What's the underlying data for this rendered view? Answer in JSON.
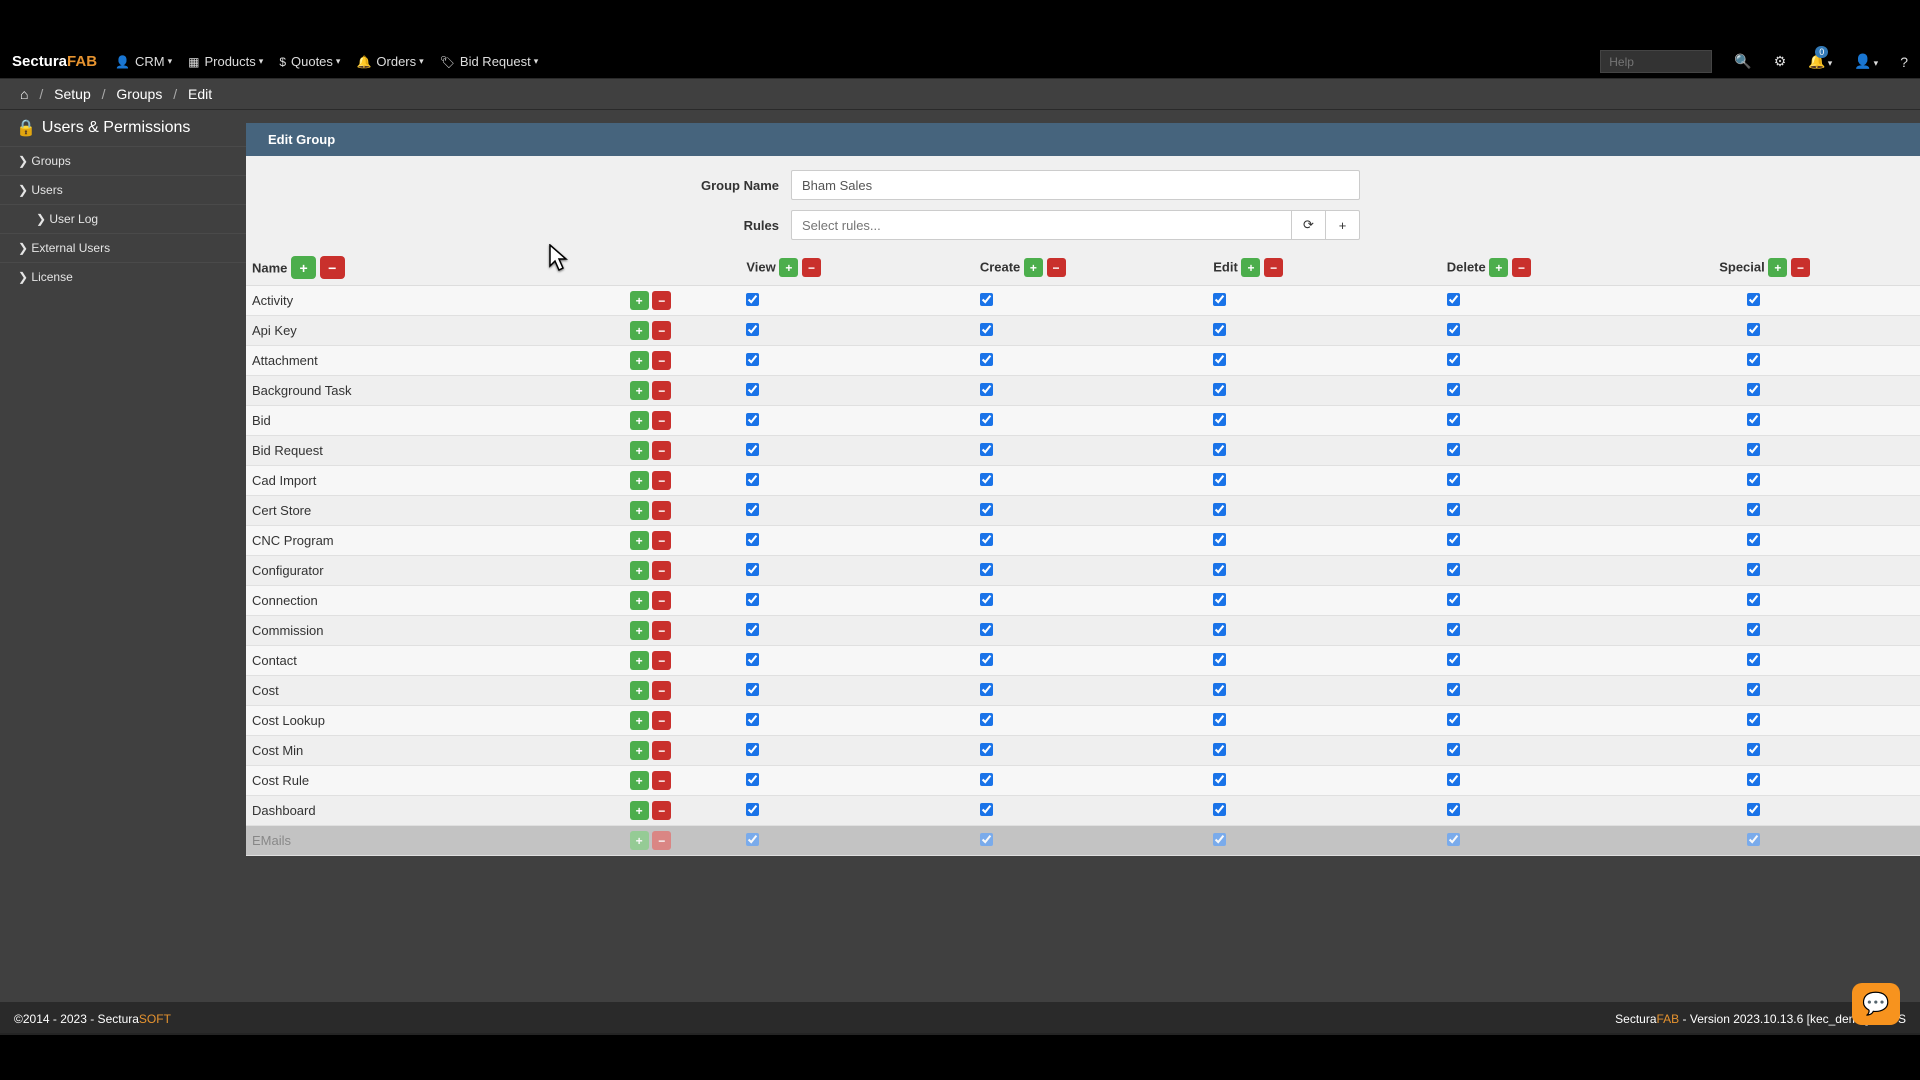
{
  "brand": {
    "part1": "Sectura",
    "part2": "FAB"
  },
  "nav": {
    "crm": "CRM",
    "products": "Products",
    "quotes": "Quotes",
    "orders": "Orders",
    "bid_request": "Bid Request",
    "help_placeholder": "Help",
    "notif_badge": "0"
  },
  "breadcrumb": {
    "setup": "Setup",
    "groups": "Groups",
    "edit": "Edit"
  },
  "sidebar": {
    "title": "Users & Permissions",
    "items": [
      "Groups",
      "Users",
      "User Log",
      "External Users",
      "License"
    ]
  },
  "panel": {
    "heading": "Edit Group",
    "group_name_label": "Group Name",
    "group_name_value": "Bham Sales",
    "rules_label": "Rules",
    "rules_placeholder": "Select rules..."
  },
  "columns": {
    "name": "Name",
    "view": "View",
    "create": "Create",
    "edit": "Edit",
    "delete": "Delete",
    "special": "Special"
  },
  "rows": [
    "Activity",
    "Api Key",
    "Attachment",
    "Background Task",
    "Bid",
    "Bid Request",
    "Cad Import",
    "Cert Store",
    "CNC Program",
    "Configurator",
    "Connection",
    "Commission",
    "Contact",
    "Cost",
    "Cost Lookup",
    "Cost Min",
    "Cost Rule",
    "Dashboard",
    "EMails"
  ],
  "footer": {
    "left1": "©2014 - 2023 - Sectura",
    "left2": "SOFT",
    "right_brand1": "Sectura",
    "right_brand2": "FAB",
    "right_ver": " - Version 2023.10.13.6 [kec_demo] en-US"
  }
}
